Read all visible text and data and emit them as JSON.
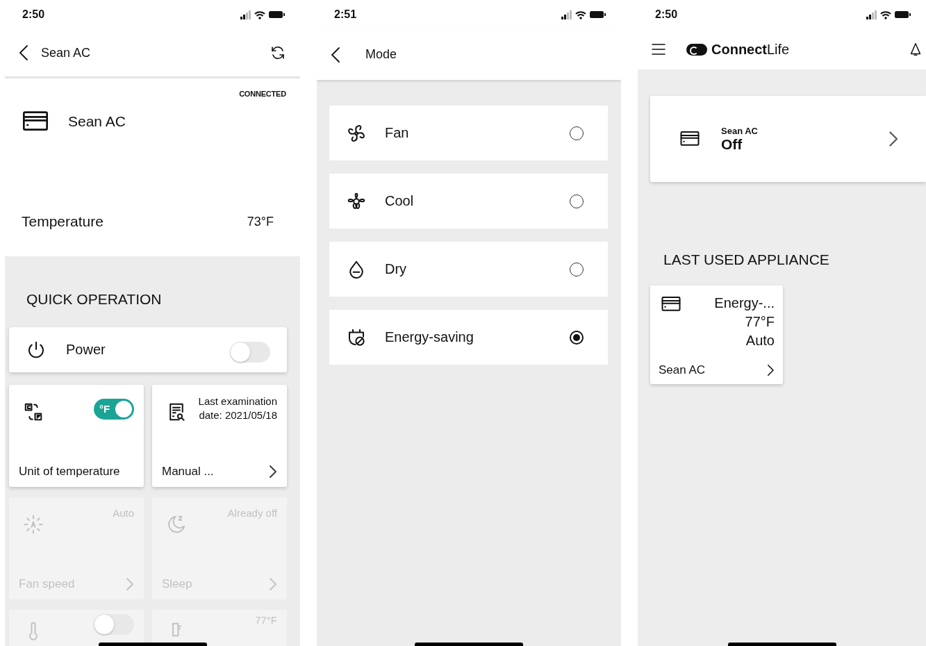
{
  "device_screen": {
    "status_bar": {
      "time": "2:50"
    },
    "header": {
      "title": "Sean AC"
    },
    "connection_status": "CONNECTED",
    "device_name": "Sean AC",
    "temperature": {
      "label": "Temperature",
      "value": "73°F"
    },
    "quick_operation": {
      "title": "QUICK OPERATION",
      "power": {
        "label": "Power",
        "on": false
      },
      "tiles": [
        {
          "kind": "unit",
          "label": "Unit of temperature",
          "toggle_label": "°F",
          "on": true,
          "disabled": false
        },
        {
          "kind": "manual",
          "label": "Manual ...",
          "value": "Last examination date: 2021/05/18",
          "disabled": false
        },
        {
          "kind": "fan",
          "label": "Fan speed",
          "value": "Auto",
          "disabled": true
        },
        {
          "kind": "sleep",
          "label": "Sleep",
          "value": "Already off",
          "disabled": true
        },
        {
          "kind": "thermo",
          "on": false,
          "disabled": true
        },
        {
          "kind": "temp",
          "value": "77°F",
          "disabled": true
        }
      ]
    }
  },
  "mode_screen": {
    "status_bar": {
      "time": "2:51"
    },
    "header": {
      "title": "Mode"
    },
    "options": [
      {
        "kind": "fan",
        "label": "Fan",
        "selected": false
      },
      {
        "kind": "cool",
        "label": "Cool",
        "selected": false
      },
      {
        "kind": "dry",
        "label": "Dry",
        "selected": false
      },
      {
        "kind": "energy",
        "label": "Energy-saving",
        "selected": true
      }
    ]
  },
  "home_screen": {
    "status_bar": {
      "time": "2:50"
    },
    "header": {
      "logo": "**Connect**Life"
    },
    "device_card": {
      "name": "Sean AC",
      "status": "Off"
    },
    "section_title": "LAST USED APPLIANCE",
    "last_used": {
      "mode": "Energy-...",
      "temperature": "77°F",
      "fan": "Auto",
      "name": "Sean AC"
    }
  }
}
